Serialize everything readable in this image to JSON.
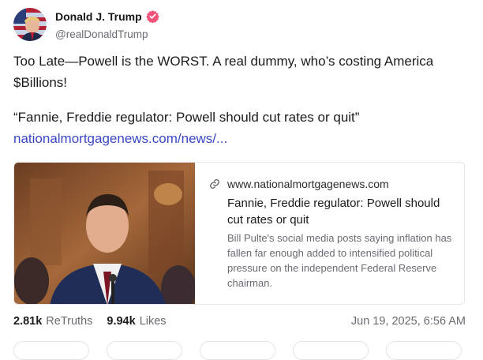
{
  "author": {
    "display_name": "Donald J. Trump",
    "handle": "@realDonaldTrump",
    "verified_color": "#f0527a"
  },
  "post": {
    "text": "Too Late—Powell is the WORST. A real dummy, who’s costing America $Billions!",
    "quote": "“Fannie, Freddie regulator: Powell should cut rates or quit”",
    "link_text": "nationalmortgagenews.com/news/..."
  },
  "link_card": {
    "domain": "www.nationalmortgagenews.com",
    "title": "Fannie, Freddie regulator: Powell should cut rates or quit",
    "description": "Bill Pulte's social media posts saying inflation has fallen far enough added to intensified political pressure on the independent Federal Reserve chairman."
  },
  "stats": {
    "retruths_count": "2.81k",
    "retruths_label": "ReTruths",
    "likes_count": "9.94k",
    "likes_label": "Likes"
  },
  "timestamp": "Jun 19, 2025, 6:56 AM",
  "colors": {
    "link": "#3a48c4",
    "muted": "#6b6b74",
    "border": "#e6e6ec"
  }
}
